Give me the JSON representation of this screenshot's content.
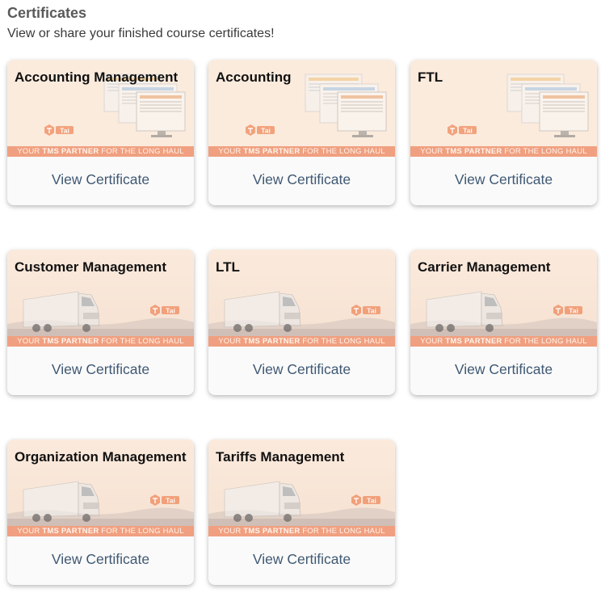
{
  "header": {
    "title": "Certificates",
    "subtitle": "View or share your finished course certificates!"
  },
  "colors": {
    "banner_bg": "#fbebdd",
    "tagline_bg": "#f0a080",
    "link": "#3f5873",
    "logo": "#ef8a5c"
  },
  "tagline_parts": [
    "YOUR ",
    "TMS PARTNER",
    " FOR THE LONG HAUL"
  ],
  "logo_text": "Tai",
  "button_label": "View Certificate",
  "certificates": [
    {
      "title": "Accounting Management",
      "art": "screens-icon"
    },
    {
      "title": "Accounting",
      "art": "screens-icon"
    },
    {
      "title": "FTL",
      "art": "screens-icon"
    },
    {
      "title": "Customer Management",
      "art": "truck-icon"
    },
    {
      "title": "LTL",
      "art": "truck-icon"
    },
    {
      "title": "Carrier Management",
      "art": "truck-icon"
    },
    {
      "title": "Organization Management",
      "art": "truck-icon"
    },
    {
      "title": "Tariffs Management",
      "art": "truck-icon"
    }
  ]
}
